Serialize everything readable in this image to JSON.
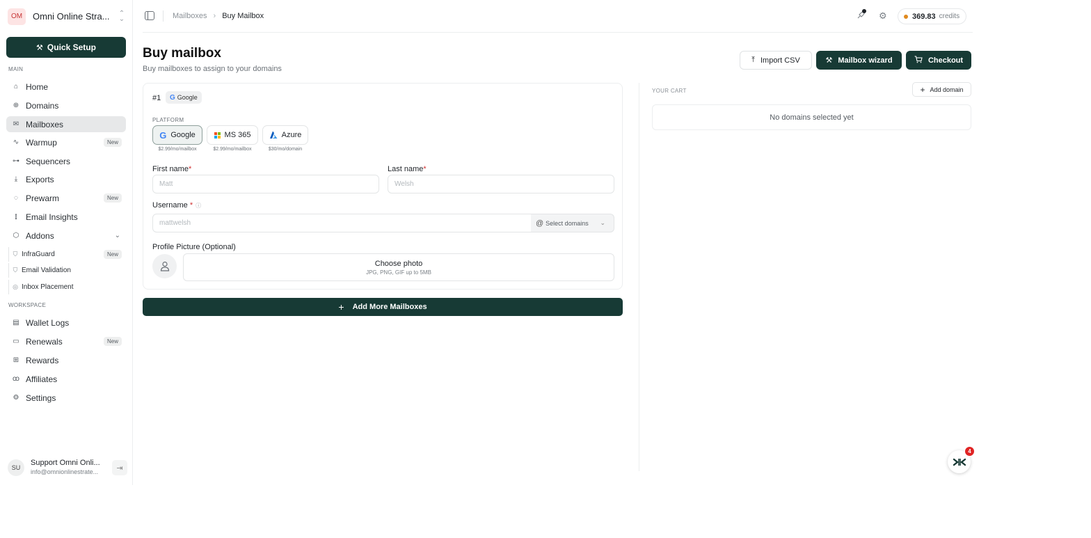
{
  "org": {
    "initials": "OM",
    "name": "Omni Online Stra..."
  },
  "sidebar": {
    "quick_setup_label": "Quick Setup",
    "main_section_label": "MAIN",
    "workspace_section_label": "WORKSPACE",
    "items": {
      "home": "Home",
      "domains": "Domains",
      "mailboxes": "Mailboxes",
      "warmup": "Warmup",
      "sequencers": "Sequencers",
      "exports": "Exports",
      "prewarm": "Prewarm",
      "email_insights": "Email Insights",
      "addons": "Addons",
      "infraguard": "InfraGuard",
      "email_validation": "Email Validation",
      "inbox_placement": "Inbox Placement",
      "wallet_logs": "Wallet Logs",
      "renewals": "Renewals",
      "rewards": "Rewards",
      "affiliates": "Affiliates",
      "settings": "Settings"
    },
    "new_badge": "New",
    "active_item": "mailboxes"
  },
  "user": {
    "initials": "SU",
    "name": "Support Omni Onli...",
    "email": "info@omnionlinestrate..."
  },
  "header": {
    "breadcrumb_parent": "Mailboxes",
    "breadcrumb_current": "Buy Mailbox",
    "credits_value": "369.83",
    "credits_unit": "credits"
  },
  "page": {
    "title": "Buy mailbox",
    "subtitle": "Buy mailboxes to assign to your domains",
    "import_csv_label": "Import CSV",
    "wizard_label": "Mailbox wizard",
    "checkout_label": "Checkout"
  },
  "form": {
    "card_number": "#1",
    "card_tag": "Google",
    "platform_label": "PLATFORM",
    "platforms": [
      {
        "name": "Google",
        "price": "$2.99/mo/mailbox",
        "selected": true
      },
      {
        "name": "MS 365",
        "price": "$2.99/mo/mailbox",
        "selected": false
      },
      {
        "name": "Azure",
        "price": "$30/mo/domain",
        "selected": false
      }
    ],
    "first_name_label": "First name",
    "first_name_placeholder": "Matt",
    "last_name_label": "Last name",
    "last_name_placeholder": "Welsh",
    "required_mark": "*",
    "username_label": "Username",
    "username_placeholder": "mattwelsh",
    "domain_select_at": "@",
    "domain_select_label": "Select domains",
    "profile_picture_label": "Profile Picture (Optional)",
    "choose_photo_label": "Choose photo",
    "choose_photo_hint": "JPG, PNG, GIF up to 5MB",
    "add_more_label": "Add More Mailboxes"
  },
  "cart": {
    "label": "YOUR CART",
    "add_domain_label": "Add domain",
    "empty_message": "No domains selected yet"
  },
  "widget": {
    "badge_count": "4"
  },
  "colors": {
    "brand": "#173a35",
    "credits_dot": "#e08a1e",
    "badge_red": "#e02424",
    "org_avatar_bg": "#fde4e4"
  }
}
